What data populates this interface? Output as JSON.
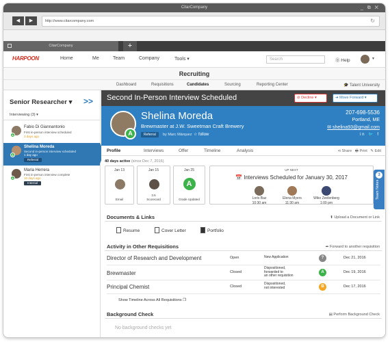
{
  "window": {
    "title": "CitarCompany",
    "controls": "_ ⧉ ✕"
  },
  "browser": {
    "url": "http://www.citarcompany.com",
    "back": "◀",
    "forward": "▶",
    "reload": "↻",
    "tab_title": "CitarCompany",
    "new_tab": "+"
  },
  "appnav": {
    "logo": "HARPOON",
    "items": [
      "Home",
      "Me",
      "Team",
      "Company",
      "Tools ▾"
    ],
    "search_placeholder": "Search",
    "help": "⓪ Help"
  },
  "page_title": "Recruiting",
  "subnav": {
    "items": [
      "Dashboard",
      "Requisitions",
      "Candidates",
      "Sourcing",
      "Reporting Center"
    ],
    "active": "Candidates",
    "talent": "🎓 Talent University"
  },
  "sidebar": {
    "title": "Senior Researcher ▾",
    "collapse": ">>",
    "filter": "Interviewing (3) ▾",
    "candidates": [
      {
        "name": "Fabio Di Giannantonio",
        "line1": "First in-person interview scheduled",
        "ago": "3 days ago",
        "badge": "",
        "dot": "A"
      },
      {
        "name": "Shelina Moreda",
        "line1": "Second in-person interview scheduled",
        "ago": "1 day ago",
        "badge": "Referral",
        "dot": "A"
      },
      {
        "name": "Maria Herrera",
        "line1": "First in-person interview complete",
        "ago": "10 days ago",
        "badge": "Internal",
        "dot": "A"
      }
    ]
  },
  "header": {
    "title": "Second In-Person Interview Scheduled",
    "decline": "Decline ▾",
    "move": "Move Forward ▾"
  },
  "profile": {
    "name": "Shelina Moreda",
    "job": "Brewmaster at J.W. Sweetman Craft Brewery",
    "referral": "Referral",
    "by": "by Marc Márquez",
    "follow": "☆ follow",
    "phone": "207-698-5536",
    "city": "Portland, ME",
    "email": "✉ shelina93@gmail.com",
    "social": "in 🐦 f",
    "grade": "A"
  },
  "tabs": {
    "items": [
      "Profile",
      "Interviews",
      "Offer",
      "Timeline",
      "Analysis"
    ],
    "active": "Profile",
    "share": "⊲ Share",
    "print": "🖶 Print",
    "edit": "✎ Edit"
  },
  "team_notes": {
    "label": "Team Notes",
    "count": "3"
  },
  "activity": {
    "days": "40 days active",
    "since": "(since Dec 7, 2016)"
  },
  "timeline_cards": [
    {
      "date": "Jan 13",
      "label": "Email",
      "kind": "pic"
    },
    {
      "date": "Jan 15",
      "label": "3.6\nScorecard",
      "kind": "pic"
    },
    {
      "date": "Jan 25",
      "label": "Grade Updated",
      "kind": "A"
    }
  ],
  "upnext": {
    "label": "UP NEXT",
    "title": "📅 Interviews Scheduled for January 30, 2017",
    "interviewers": [
      {
        "name": "Loris Baz",
        "time": "10:30 am"
      },
      {
        "name": "Elena Myers",
        "time": "11:30 am"
      },
      {
        "name": "Wiko Zeelenberg",
        "time": "1:00 pm"
      }
    ]
  },
  "documents": {
    "title": "Documents & Links",
    "upload": "⬆ Upload a Document or Link",
    "items": [
      "Resume",
      "Cover Letter",
      "Portfolio"
    ]
  },
  "requisitions": {
    "title": "Activity in Other Requisitions",
    "forward": "➦ Forward to another requisition",
    "rows": [
      {
        "name": "Director of Research and Development",
        "status": "Open",
        "reason": "New Application",
        "badge": "?",
        "badge_color": "#888888",
        "date": "Dec 21, 2016"
      },
      {
        "name": "Brewmaster",
        "status": "Closed",
        "reason": "Dispositioned,\nforwarded to\nan other requisition",
        "badge": "A",
        "badge_color": "#3cb34a",
        "date": "Dec 19, 2016"
      },
      {
        "name": "Principal Chemist",
        "status": "Closed",
        "reason": "Dispositioned,\nnot interested",
        "badge": "B",
        "badge_color": "#f5a623",
        "date": "Dec 17, 2016"
      }
    ],
    "show_timeline": "Show Timeline Across All Requisitions ❐"
  },
  "background": {
    "title": "Background Check",
    "perform": "▤ Perform Background Check",
    "empty": "No background checks yet"
  }
}
